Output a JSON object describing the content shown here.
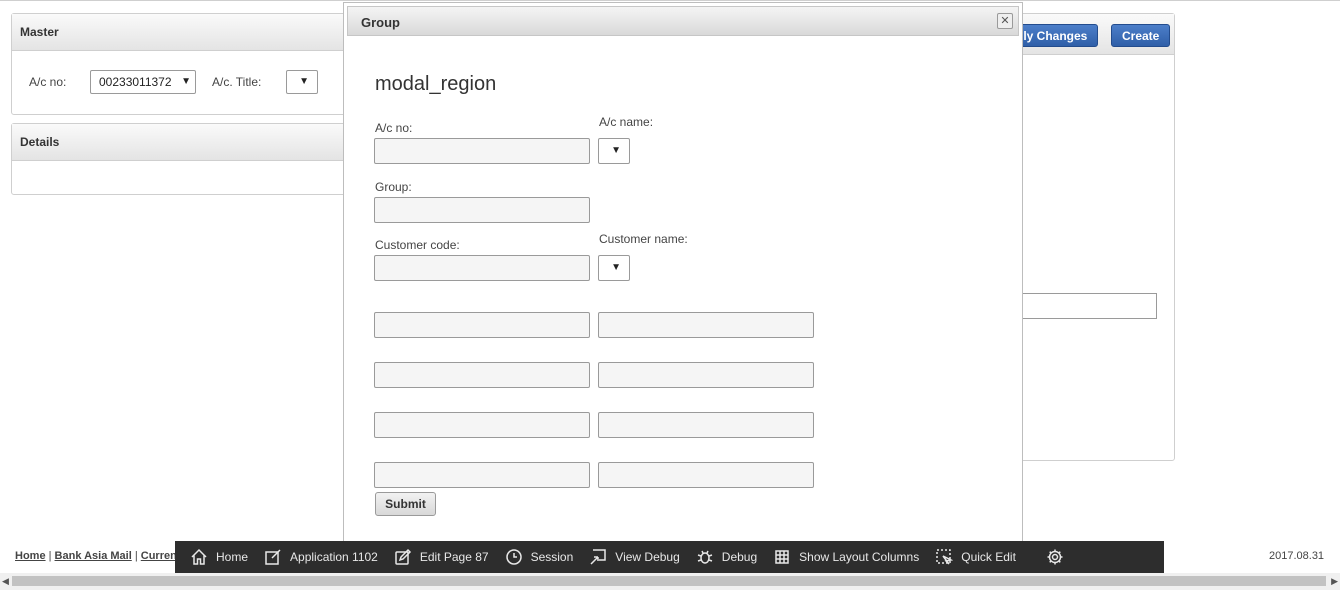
{
  "master": {
    "title": "Master",
    "ac_no_label": "A/c no:",
    "ac_no_value": "00233011372",
    "ac_title_label": "A/c. Title:"
  },
  "details": {
    "title": "Details"
  },
  "toolbar": {
    "apply_label": "ply Changes",
    "create_label": "Create"
  },
  "dialog": {
    "title": "Group",
    "region_title": "modal_region",
    "fields": {
      "ac_no_label": "A/c no:",
      "ac_name_label": "A/c name:",
      "group_label": "Group:",
      "customer_code_label": "Customer code:",
      "customer_name_label": "Customer name:"
    },
    "submit_label": "Submit"
  },
  "footer": {
    "links": [
      "Home",
      "Bank Asia Mail",
      "Curren"
    ],
    "date": "2017.08.31"
  },
  "dev_toolbar": {
    "items": [
      {
        "label": "Home",
        "icon": "home-icon"
      },
      {
        "label": "Application 1102",
        "icon": "edit-icon"
      },
      {
        "label": "Edit Page 87",
        "icon": "pencil-icon"
      },
      {
        "label": "Session",
        "icon": "clock-icon"
      },
      {
        "label": "View Debug",
        "icon": "view-debug-icon"
      },
      {
        "label": "Debug",
        "icon": "bug-icon"
      },
      {
        "label": "Show Layout Columns",
        "icon": "grid-icon"
      },
      {
        "label": "Quick Edit",
        "icon": "quick-edit-icon"
      }
    ],
    "gear_icon": "gear-icon"
  }
}
